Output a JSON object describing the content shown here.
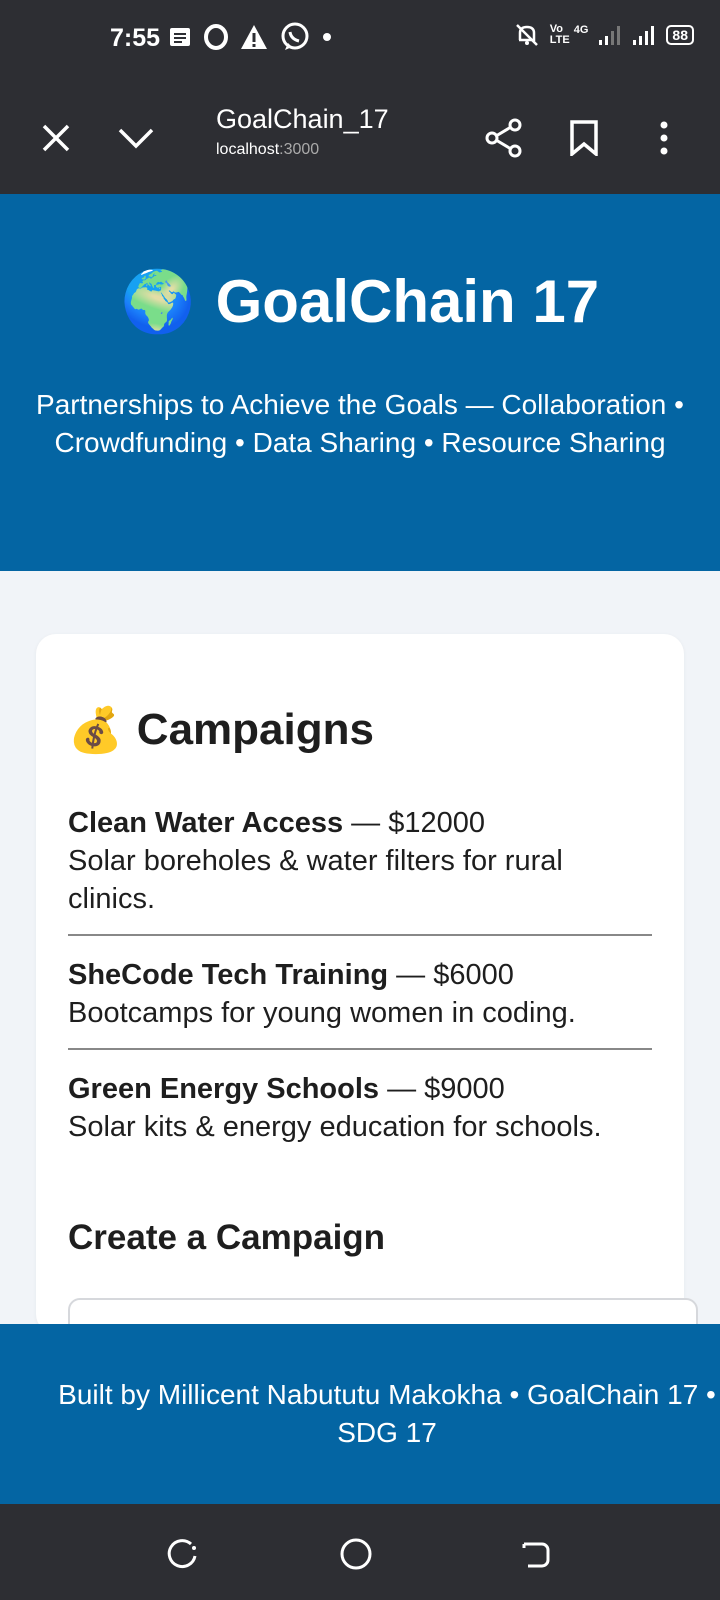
{
  "status_bar": {
    "time": "7:55",
    "battery": "88",
    "left_icons": [
      "notes-icon",
      "opera-icon",
      "alert-icon",
      "whatsapp-icon",
      "dot-icon"
    ],
    "right_icons": [
      "mute-icon",
      "volte-icon",
      "signal-icon",
      "signal-icon",
      "battery-icon"
    ],
    "volte_label": "Vo LTE",
    "net_label": "4G"
  },
  "browser": {
    "title": "GoalChain_17",
    "url_host": "localhost",
    "url_port": ":3000"
  },
  "hero": {
    "emoji": "🌍",
    "title": "GoalChain 17",
    "subtitle": "Partnerships to Achieve the Goals — Collaboration • Crowdfunding • Data Sharing • Resource Sharing"
  },
  "campaigns": {
    "emoji": "💰",
    "heading": "Campaigns",
    "items": [
      {
        "name": "Clean Water Access",
        "sep": " — ",
        "amount": "$12000",
        "description": "Solar boreholes & water filters for rural clinics."
      },
      {
        "name": "SheCode Tech Training",
        "sep": " — ",
        "amount": "$6000",
        "description": "Bootcamps for young women in coding."
      },
      {
        "name": "Green Energy Schools",
        "sep": " — ",
        "amount": "$9000",
        "description": "Solar kits & energy education for schools."
      }
    ],
    "create_heading": "Create a Campaign"
  },
  "footer": {
    "text": "Built by Millicent Nabututu Makokha • GoalChain 17 • SDG 17"
  },
  "colors": {
    "brand_blue": "#0465a3",
    "system_bar": "#2d2e33",
    "page_bg": "#f1f4f8"
  }
}
